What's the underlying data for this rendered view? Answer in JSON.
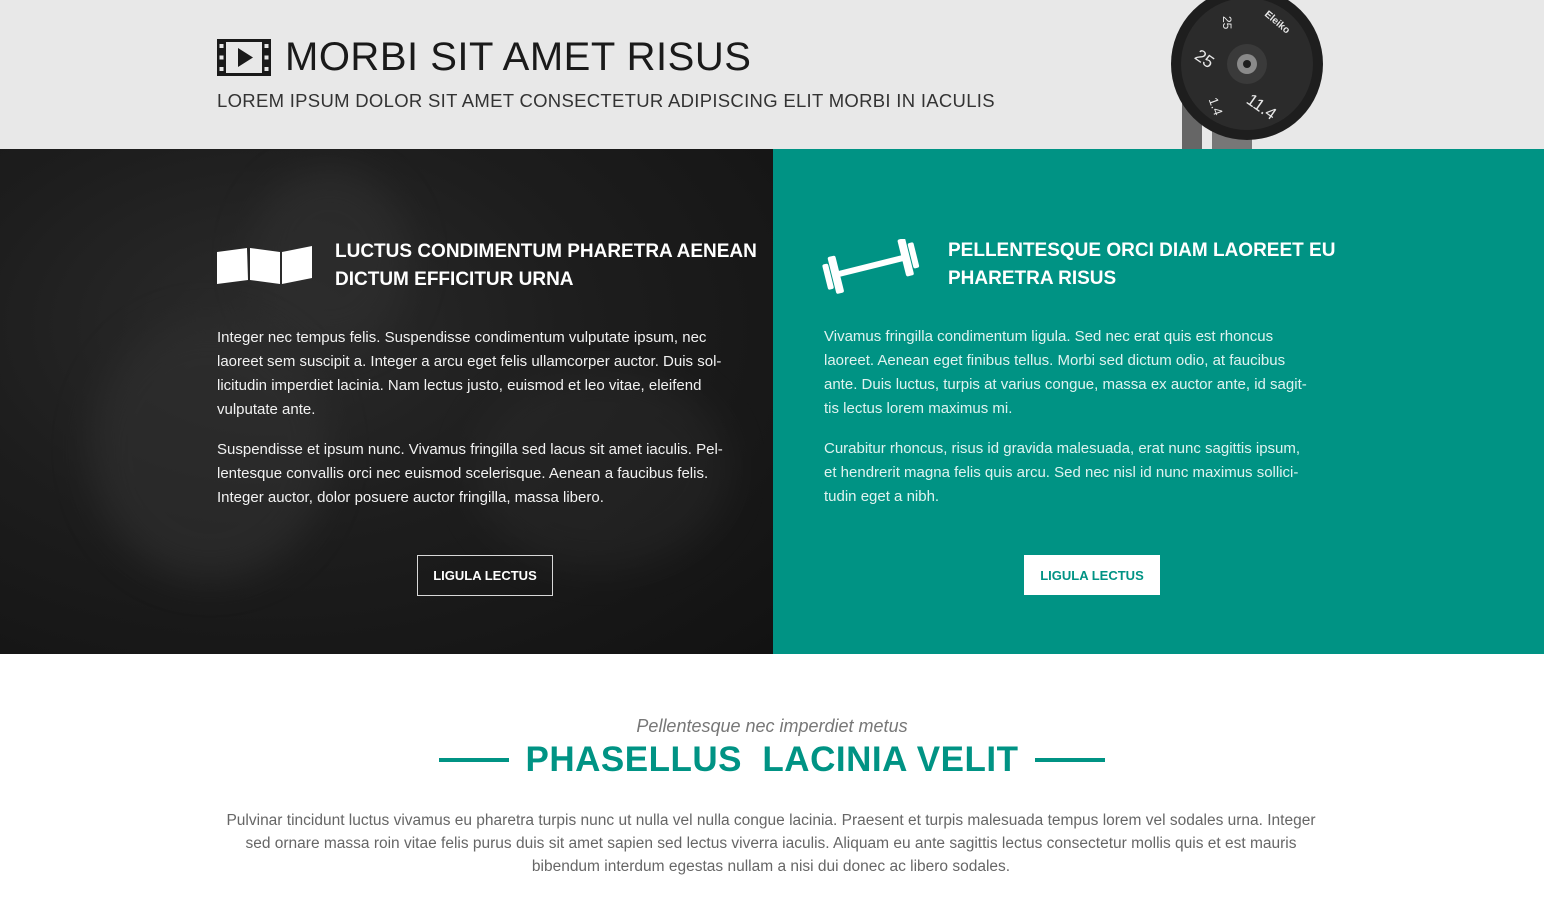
{
  "header": {
    "title": "MORBI SIT AMET RISUS",
    "subtitle": "LOREM IPSUM DOLOR SIT AMET CONSECTETUR ADIPISCING ELIT MORBI IN IACULIS",
    "icon": "film-play-icon",
    "plate_labels": [
      "25",
      "11.4",
      "25",
      "1.4"
    ],
    "plate_brand": "Eleiko"
  },
  "panels": [
    {
      "icon": "map-fold-icon",
      "heading_line1": "LUCTUS CONDIMENTUM PHARETRA AENEAN",
      "heading_line2": "DICTUM EFFICITUR URNA",
      "para1_lines": [
        "Integer nec tempus felis. Suspendisse condimentum vulputate ipsum, nec",
        "laoreet sem suscipit a. Integer a arcu eget felis ullamcorper auctor. Duis sol-",
        "licitudin imperdiet lacinia. Nam lectus justo, euismod et leo vitae, eleifend",
        "vulputate ante."
      ],
      "para2_lines": [
        "Suspendisse et ipsum nunc. Vivamus fringilla sed lacus sit amet iaculis. Pel-",
        "lentesque convallis orci nec euismod scelerisque. Aenean a faucibus felis.",
        "Integer auctor, dolor posuere auctor fringilla, massa libero."
      ],
      "button": "LIGULA LECTUS",
      "background": "#1a1a1a"
    },
    {
      "icon": "dumbbell-icon",
      "heading_line1": "PELLENTESQUE ORCI DIAM LAOREET EU",
      "heading_line2": "PHARETRA RISUS",
      "para1_lines": [
        "Vivamus fringilla condimentum ligula. Sed nec erat quis est rhoncus",
        "laoreet. Aenean eget finibus tellus. Morbi sed dictum odio, at faucibus",
        "ante. Duis luctus, turpis at varius congue, massa ex auctor ante, id sagit-",
        "tis lectus lorem maximus mi."
      ],
      "para2_lines": [
        "Curabitur rhoncus, risus id gravida malesuada, erat nunc sagittis ipsum,",
        "et hendrerit magna felis quis arcu. Sed nec nisl id nunc maximus sollici-",
        "tudin eget a nibh."
      ],
      "button": "LIGULA LECTUS",
      "background": "#009384"
    }
  ],
  "section": {
    "eyebrow": "Pellentesque nec imperdiet metus",
    "title": "PHASELLUS  LACINIA VELIT",
    "para_lines": [
      "Pulvinar tincidunt luctus vivamus eu pharetra turpis nunc ut nulla vel nulla congue lacinia. Praesent et turpis malesuada tempus lorem vel sodales urna. Integer",
      "sed ornare massa roin vitae felis purus duis sit amet sapien sed lectus viverra iaculis. Aliquam eu ante sagittis lectus consectetur mollis quis et est mauris",
      "bibendum interdum egestas nullam a nisi dui donec ac libero sodales."
    ],
    "accent": "#009384"
  }
}
